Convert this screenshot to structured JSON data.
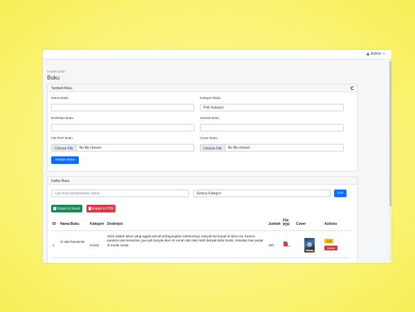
{
  "topbar": {
    "user_label": "Admin"
  },
  "header": {
    "overline": "OVERVIEW",
    "title": "Buku"
  },
  "form": {
    "title": "Tambah Buku",
    "nama_label": "Nama Buku",
    "nama_value": "",
    "kategori_label": "Kategori Buku",
    "kategori_value": "Pilih Kategori",
    "deskripsi_label": "Deskripsi Buku",
    "deskripsi_value": "",
    "jumlah_label": "Jumlah Buku",
    "jumlah_value": "",
    "pdf_label": "File PDF Buku",
    "cover_label": "Cover Buku",
    "choose_file": "Choose File",
    "no_file": "No file chosen",
    "submit_label": "Simpan Buku"
  },
  "list": {
    "title": "Daftar Buku",
    "search_placeholder": "Cari buku berdasarkan nama...",
    "category_filter": "Semua Kategori",
    "search_button": "Cari",
    "export_excel": "Export to Excel",
    "export_pdf": "Export to PDF",
    "columns": [
      "ID",
      "Nama Buku",
      "Kategori",
      "Deskripsi",
      "Jumlah",
      "File PDF",
      "Cover",
      "Actions"
    ],
    "rows": [
      {
        "id": "1",
        "nama": "Si Juki Pandemik",
        "kategori": "Komik",
        "deskripsi": "2020 adalah tahun yang nggak pernah terbayangkan sebelumnya, banyak hal terjadi di tahun itu. Karena pandemi dan karantina, gue jadi banyak diem di rumah dan bikin lebih banyak bikin komik. Sekalian biar panjat di media sosial.",
        "jumlah": "100",
        "pdf_label": "PDF",
        "edit_label": "Edit",
        "delete_label": "Delete"
      }
    ]
  },
  "colors": {
    "primary": "#0d6efd",
    "success": "#198754",
    "danger": "#dc3545",
    "warning": "#ffc107"
  }
}
